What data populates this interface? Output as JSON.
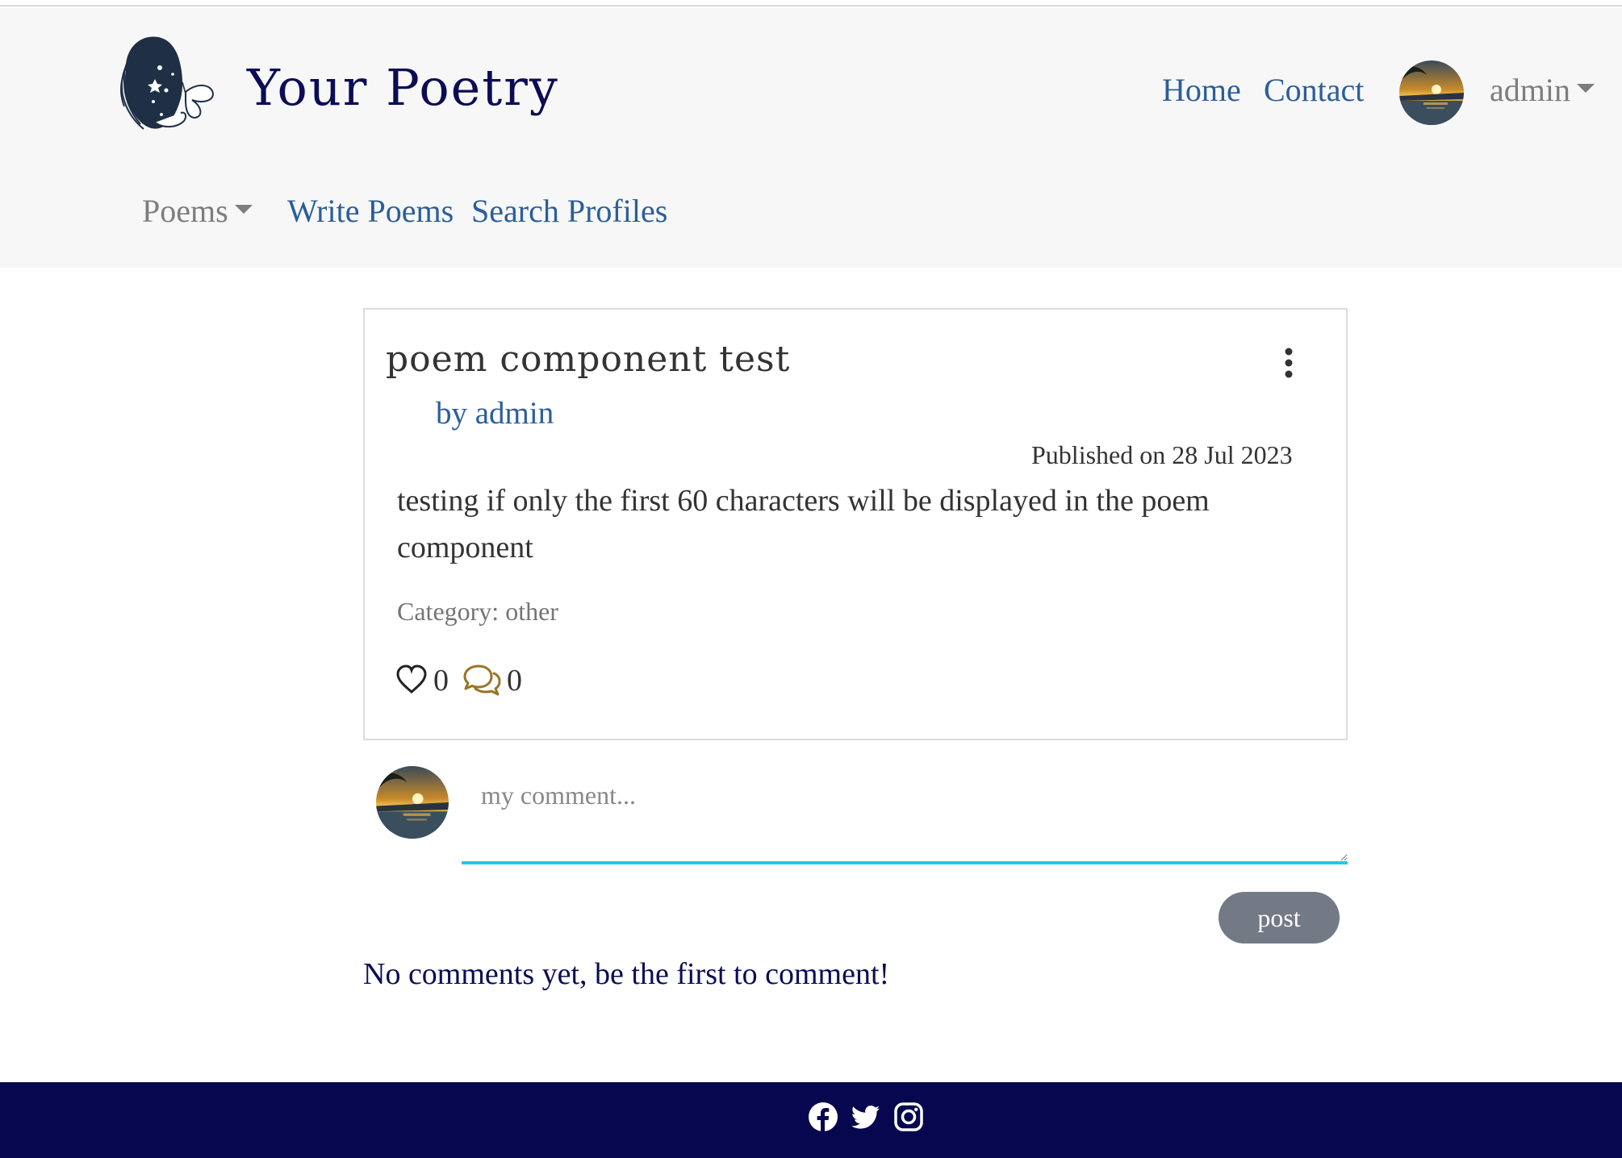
{
  "brand": {
    "title": "Your Poetry",
    "logo_icon": "woman-butterfly-logo-icon",
    "color": "#0c0c55"
  },
  "top_nav": {
    "home": "Home",
    "contact": "Contact",
    "user": "admin",
    "avatar": "sunset-avatar"
  },
  "sub_nav": {
    "poems": "Poems",
    "write": "Write Poems",
    "search_profiles": "Search Profiles"
  },
  "poem": {
    "title": "poem component test",
    "author": "by admin",
    "published": "Published on 28 Jul 2023",
    "excerpt": "testing if only the first 60 characters will be displayed in the poem component",
    "category_label": "Category:",
    "category_value": "other",
    "likes": "0",
    "comments": "0",
    "menu_icon": "more-vertical-icon",
    "like_icon": "heart-icon",
    "comment_icon": "chat-bubbles-icon"
  },
  "comment_form": {
    "placeholder": "my comment...",
    "post_label": "post",
    "accent": "#22c7e8"
  },
  "comments": {
    "empty_message": "No comments yet, be the first to comment!"
  },
  "footer": {
    "icons": [
      "facebook-icon",
      "twitter-icon",
      "instagram-icon"
    ],
    "background": "#07074f"
  },
  "colors": {
    "link": "#2b5e9a",
    "muted": "#7d7d7d",
    "button": "#737985",
    "comment_icon": "#9a7424"
  }
}
